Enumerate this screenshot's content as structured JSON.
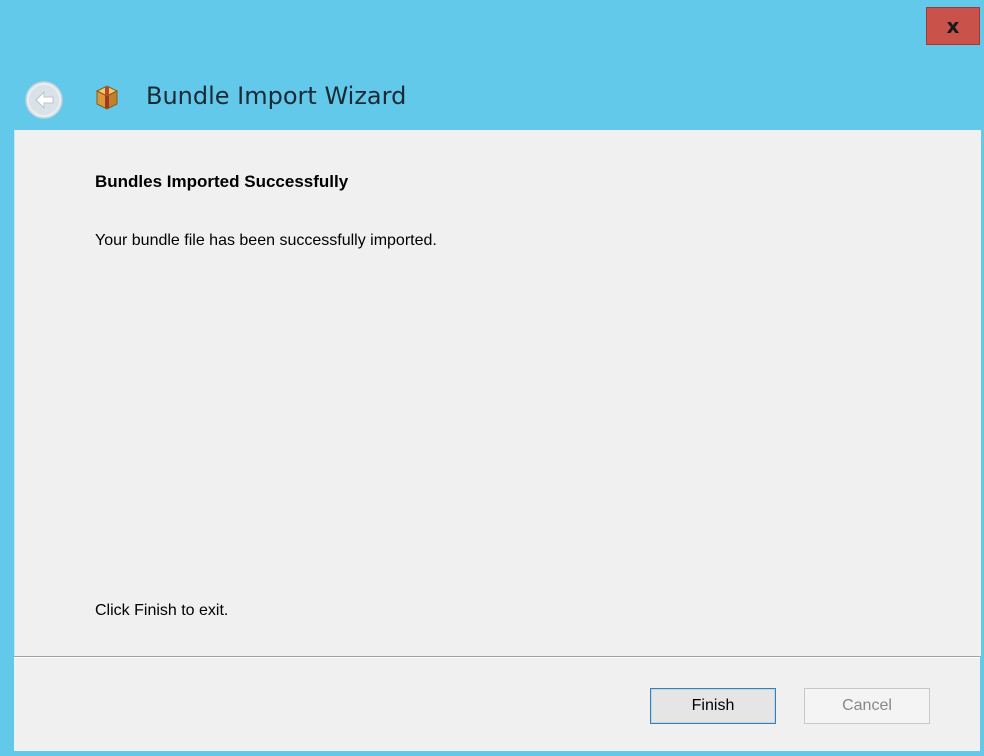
{
  "window": {
    "close_label": "x",
    "accent_color": "#63c9ea",
    "close_color": "#c9524a"
  },
  "header": {
    "title": "Bundle Import Wizard",
    "back_icon": "back-arrow-icon",
    "app_icon": "package-icon"
  },
  "page": {
    "heading": "Bundles Imported Successfully",
    "message": "Your bundle file has been successfully imported.",
    "footer_text": "Click Finish to exit."
  },
  "buttons": {
    "finish_label": "Finish",
    "cancel_label": "Cancel"
  }
}
